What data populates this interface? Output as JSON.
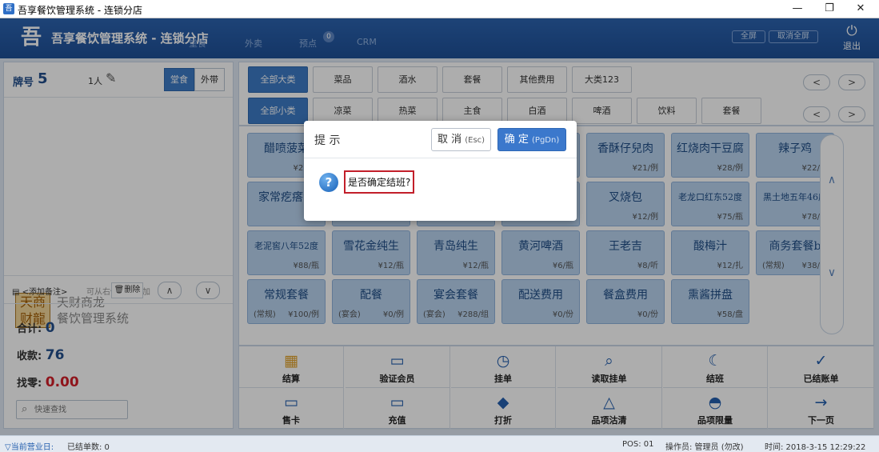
{
  "window": {
    "title": "吾享餐饮管理系统 - 连锁分店",
    "min": "—",
    "restore": "❐",
    "close": "✕"
  },
  "header": {
    "logo": "吾",
    "title": "吾享餐饮管理系统 - 连锁分店",
    "nav": [
      "堂食",
      "外卖",
      "预点",
      "CRM"
    ],
    "preorder_badge": "0",
    "fullscreen_label": "全屏",
    "exit_fullscreen_label": "取消全屏",
    "exit_label": "退出",
    "exit_icon": "⏻"
  },
  "order": {
    "table_label": "牌号",
    "table_no": "5",
    "guests": "1人",
    "edit_icon": "✎",
    "mode_dine_in": "堂食",
    "mode_takeout": "外带",
    "add_remark": "<添加备注>",
    "hint": "可从右侧双击添加",
    "delete_label": "删除",
    "up": "∧",
    "down": "∨"
  },
  "brand": {
    "logo_text": "天商财龍",
    "line1": "天财商龙",
    "line2": "餐饮管理系统"
  },
  "totals": {
    "total_label": "合计:",
    "total": "0",
    "received_label": "收款:",
    "received": "76",
    "change_label": "找零:",
    "change": "0.00"
  },
  "search": {
    "placeholder": "快速查找",
    "icon": "⌕"
  },
  "categories": {
    "big": [
      "全部大类",
      "菜品",
      "酒水",
      "套餐",
      "其他费用",
      "大类123"
    ],
    "small": [
      "全部小类",
      "凉菜",
      "热菜",
      "主食",
      "白酒",
      "啤酒",
      "饮料",
      "套餐"
    ],
    "prev": "<",
    "next": ">"
  },
  "dishes": [
    {
      "name": "醋喷菠菜",
      "tag": "",
      "price": "¥21/例"
    },
    {
      "name": "",
      "tag": "",
      "price": ""
    },
    {
      "name": "",
      "tag": "",
      "price": ""
    },
    {
      "name": "",
      "tag": "",
      "price": ""
    },
    {
      "name": "香酥仔兒肉",
      "tag": "",
      "price": "¥21/例"
    },
    {
      "name": "红烧肉干豆腐",
      "tag": "",
      "price": "¥28/例"
    },
    {
      "name": "辣子鸡",
      "tag": "",
      "price": "¥22/例"
    },
    {
      "name": "家常疙瘩汤",
      "tag": "",
      "price": "¥1"
    },
    {
      "name": "",
      "tag": "",
      "price": ""
    },
    {
      "name": "",
      "tag": "",
      "price": ""
    },
    {
      "name": "",
      "tag": "",
      "price": ""
    },
    {
      "name": "叉烧包",
      "tag": "",
      "price": "¥12/例"
    },
    {
      "name": "老龙口红东52度",
      "tag": "",
      "price": "¥75/瓶",
      "small": true
    },
    {
      "name": "黑土地五年46度",
      "tag": "",
      "price": "¥78/瓶",
      "small": true
    },
    {
      "name": "老泥窖八年52度",
      "tag": "",
      "price": "¥88/瓶",
      "small": true
    },
    {
      "name": "雪花金纯生",
      "tag": "",
      "price": "¥12/瓶"
    },
    {
      "name": "青岛纯生",
      "tag": "",
      "price": "¥12/瓶"
    },
    {
      "name": "黄河啤酒",
      "tag": "",
      "price": "¥6/瓶"
    },
    {
      "name": "王老吉",
      "tag": "",
      "price": "¥8/听"
    },
    {
      "name": "酸梅汁",
      "tag": "",
      "price": "¥12/扎"
    },
    {
      "name": "商务套餐b",
      "tag": "(常规)",
      "price": "¥38/例"
    },
    {
      "name": "常规套餐",
      "tag": "(常规)",
      "price": "¥100/例"
    },
    {
      "name": "配餐",
      "tag": "(宴会)",
      "price": "¥0/例"
    },
    {
      "name": "宴会套餐",
      "tag": "(宴会)",
      "price": "¥288/组"
    },
    {
      "name": "配送费用",
      "tag": "",
      "price": "¥0/份"
    },
    {
      "name": "餐盒费用",
      "tag": "",
      "price": "¥0/份"
    },
    {
      "name": "熏酱拼盘",
      "tag": "",
      "price": "¥58/盘"
    }
  ],
  "scroll": {
    "up": "∧",
    "down": "∨"
  },
  "functions": [
    {
      "label": "结算",
      "icon": "▦",
      "color": "#e0a12a"
    },
    {
      "label": "验证会员",
      "icon": "▭",
      "color": "#245fae"
    },
    {
      "label": "挂单",
      "icon": "◷",
      "color": "#245fae"
    },
    {
      "label": "读取挂单",
      "icon": "⌕",
      "color": "#245fae"
    },
    {
      "label": "结班",
      "icon": "☾",
      "color": "#245fae"
    },
    {
      "label": "已结账单",
      "icon": "✓",
      "color": "#245fae"
    },
    {
      "label": "售卡",
      "icon": "▭",
      "color": "#245fae"
    },
    {
      "label": "充值",
      "icon": "▭",
      "color": "#245fae"
    },
    {
      "label": "打折",
      "icon": "◆",
      "color": "#245fae"
    },
    {
      "label": "品项沽清",
      "icon": "△",
      "color": "#245fae"
    },
    {
      "label": "品项限量",
      "icon": "◓",
      "color": "#245fae"
    },
    {
      "label": "下一页",
      "icon": "→",
      "color": "#245fae"
    }
  ],
  "status": {
    "business_day": "▽当前营业日:",
    "closed_bills": "已结单数: 0",
    "pos": "POS: 01",
    "operator": "操作员: 管理员 (勿改)",
    "time": "时间: 2018-3-15 12:29:22"
  },
  "dialog": {
    "title": "提 示",
    "cancel_label": "取 消",
    "cancel_hint": "(Esc)",
    "ok_label": "确 定",
    "ok_hint": "(PgDn)",
    "icon": "?",
    "message": "是否确定结班?"
  }
}
